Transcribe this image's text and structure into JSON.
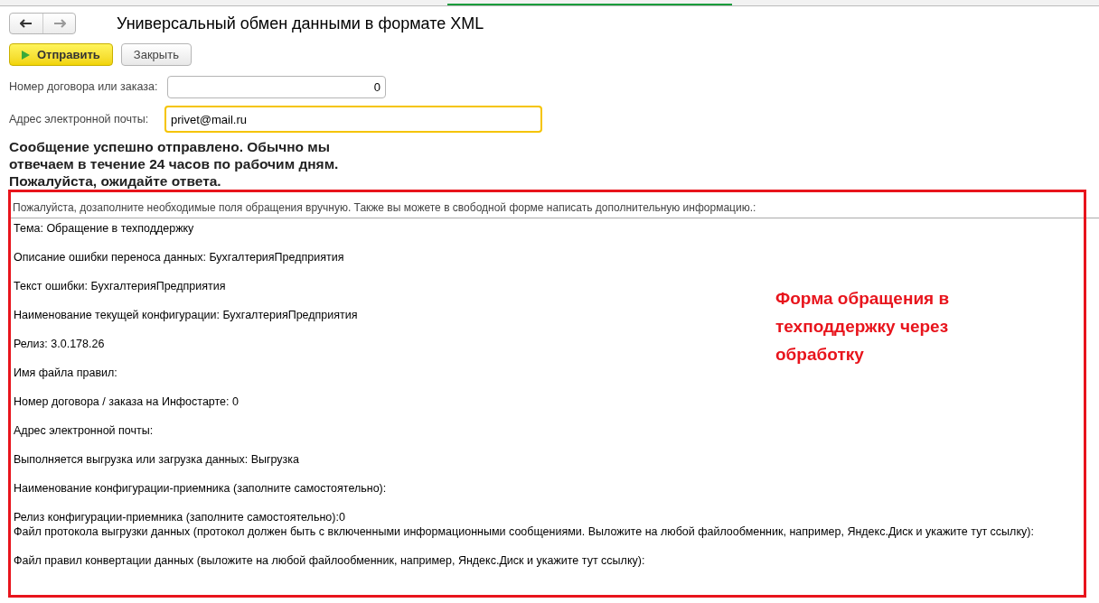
{
  "window": {
    "title": "Универсальный обмен данными в формате XML"
  },
  "toolbar": {
    "buttons": [
      {
        "label": "Отправить",
        "kind": "primary"
      },
      {
        "label": "Закрыть",
        "kind": "default"
      }
    ]
  },
  "fields": [
    {
      "label": "Номер договора или заказа:",
      "value": "0",
      "kind": "number",
      "focused": false
    },
    {
      "label": "Адрес электронной почты:",
      "value": "privet@mail.ru",
      "kind": "text",
      "focused": true
    }
  ],
  "message": "Сообщение успешно отправлено. Обычно мы отвечаем в течение 24 часов по рабочим дням. Пожалуйста, ожидайте ответа.",
  "request": {
    "label": "Пожалуйста, дозаполните необходимые поля обращения вручную. Также вы можете в свободной форме написать дополнительную информацию.:",
    "text": "Тема: Обращение в техподдержку\n\nОписание ошибки переноса данных: БухгалтерияПредприятия\n\nТекст ошибки: БухгалтерияПредприятия\n\nНаименование текущей конфигурации: БухгалтерияПредприятия\n\nРелиз: 3.0.178.26\n\nИмя файла правил:\n\nНомер договора / заказа на Инфостарте: 0\n\nАдрес электронной почты:\n\nВыполняется выгрузка или загрузка данных: Выгрузка\n\nНаименование конфигурации-приемника (заполните самостоятельно):\n\nРелиз конфигурации-приемника (заполните самостоятельно):0\nФайл протокола выгрузки данных (протокол должен быть с включенными информационными сообщениями. Выложите на любой файлообменник, например, Яндекс.Диск и укажите тут ссылку):\n\nФайл правил конвертации данных (выложите на любой файлообменник, например, Яндекс.Диск и укажите тут ссылку):"
  },
  "annotation": "Форма обращения в техподдержку через обработку"
}
